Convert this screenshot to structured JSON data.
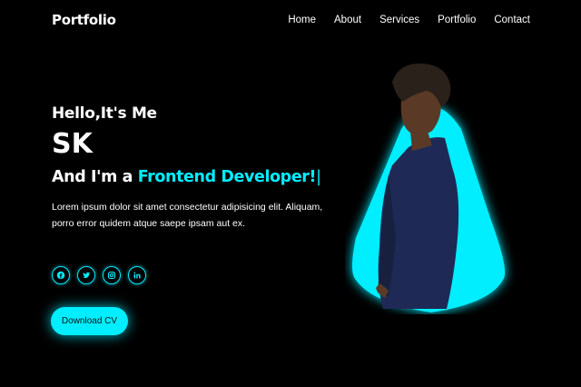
{
  "header": {
    "logo": "Portfolio",
    "nav": [
      "Home",
      "About",
      "Services",
      "Portfolio",
      "Contact"
    ]
  },
  "hero": {
    "greeting": "Hello,It's Me",
    "name": "SK",
    "role_prefix": "And I'm a ",
    "role_highlight": "Frontend Developer!",
    "cursor": "|",
    "description": "Lorem ipsum dolor sit amet consectetur adipisicing elit. Aliquam, porro error quidem atque saepe ipsam aut ex.",
    "socials": [
      "facebook-icon",
      "twitter-icon",
      "instagram-icon",
      "linkedin-icon"
    ],
    "button_label": "Download CV"
  },
  "colors": {
    "background": "#000000",
    "accent": "#00eeff",
    "text": "#ffffff",
    "shirt": "#1e2a55",
    "skin": "#5a3a26"
  }
}
